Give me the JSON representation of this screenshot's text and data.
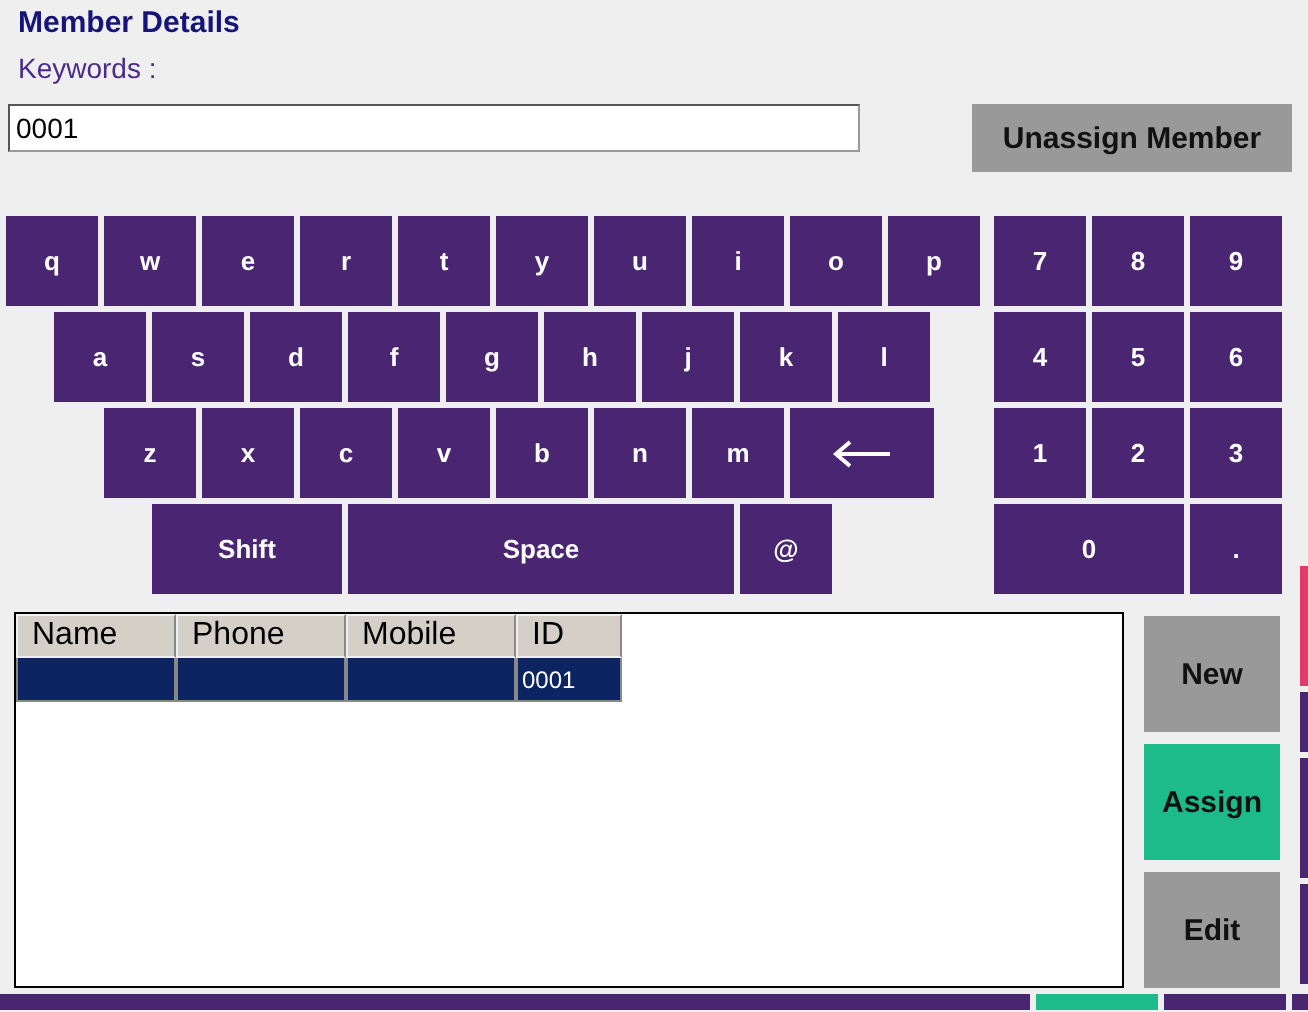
{
  "title": "Member Details",
  "search": {
    "label": "Keywords :",
    "value": "0001"
  },
  "unassign_button": "Unassign Member",
  "keyboard": {
    "rows": [
      [
        {
          "kind": "char",
          "label": "q"
        },
        {
          "kind": "char",
          "label": "w"
        },
        {
          "kind": "char",
          "label": "e"
        },
        {
          "kind": "char",
          "label": "r"
        },
        {
          "kind": "char",
          "label": "t"
        },
        {
          "kind": "char",
          "label": "y"
        },
        {
          "kind": "char",
          "label": "u"
        },
        {
          "kind": "char",
          "label": "i"
        },
        {
          "kind": "char",
          "label": "o"
        },
        {
          "kind": "char",
          "label": "p"
        }
      ],
      [
        {
          "kind": "char",
          "label": "a"
        },
        {
          "kind": "char",
          "label": "s"
        },
        {
          "kind": "char",
          "label": "d"
        },
        {
          "kind": "char",
          "label": "f"
        },
        {
          "kind": "char",
          "label": "g"
        },
        {
          "kind": "char",
          "label": "h"
        },
        {
          "kind": "char",
          "label": "j"
        },
        {
          "kind": "char",
          "label": "k"
        },
        {
          "kind": "char",
          "label": "l"
        }
      ],
      [
        {
          "kind": "char",
          "label": "z"
        },
        {
          "kind": "char",
          "label": "x"
        },
        {
          "kind": "char",
          "label": "c"
        },
        {
          "kind": "char",
          "label": "v"
        },
        {
          "kind": "char",
          "label": "b"
        },
        {
          "kind": "char",
          "label": "n"
        },
        {
          "kind": "char",
          "label": "m"
        },
        {
          "kind": "backspace"
        }
      ],
      [
        {
          "kind": "shift",
          "label": "Shift"
        },
        {
          "kind": "space",
          "label": "Space"
        },
        {
          "kind": "char",
          "label": "@"
        }
      ]
    ],
    "numpad": [
      [
        {
          "kind": "char",
          "label": "7"
        },
        {
          "kind": "char",
          "label": "8"
        },
        {
          "kind": "char",
          "label": "9"
        }
      ],
      [
        {
          "kind": "char",
          "label": "4"
        },
        {
          "kind": "char",
          "label": "5"
        },
        {
          "kind": "char",
          "label": "6"
        }
      ],
      [
        {
          "kind": "char",
          "label": "1"
        },
        {
          "kind": "char",
          "label": "2"
        },
        {
          "kind": "char",
          "label": "3"
        }
      ],
      [
        {
          "kind": "zero",
          "label": "0"
        },
        {
          "kind": "char",
          "label": "."
        }
      ]
    ]
  },
  "table": {
    "columns": [
      "Name",
      "Phone",
      "Mobile",
      "ID"
    ],
    "rows": [
      {
        "selected": true,
        "cells": [
          "",
          "",
          "",
          "0001"
        ]
      }
    ]
  },
  "actions": [
    {
      "label": "New",
      "kind": "plain"
    },
    {
      "label": "Assign",
      "kind": "primary"
    },
    {
      "label": "Edit",
      "kind": "plain"
    }
  ]
}
